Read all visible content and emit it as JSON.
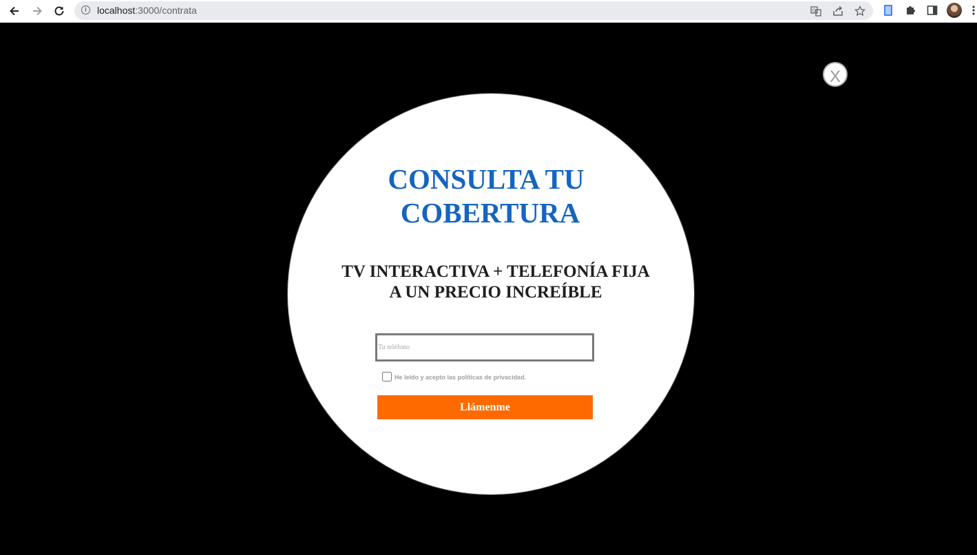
{
  "browser": {
    "url_host": "localhost",
    "url_path": ":3000/contrata",
    "icons": {
      "back": "arrow-left-icon",
      "forward": "arrow-right-icon",
      "reload": "reload-icon",
      "info": "info-icon",
      "translate": "translate-icon",
      "share": "share-icon",
      "bookmark": "star-icon",
      "extension_doc": "document-extension-icon",
      "extensions": "puzzle-icon",
      "side_panel": "side-panel-icon",
      "profile": "avatar",
      "menu": "kebab-menu-icon"
    }
  },
  "modal": {
    "close_label": "X",
    "title_line1": "CONSULTA TU",
    "title_line2": "COBERTURA",
    "subtitle_line1": "TV INTERACTIVA + TELEFONÍA FIJA",
    "subtitle_line2": "A UN PRECIO INCREÍBLE",
    "phone_placeholder": "Tu teléfono",
    "phone_value": "",
    "privacy_label": "He leído y acepto las políticas de privacidad.",
    "privacy_checked": false,
    "submit_label": "Llámenme",
    "colors": {
      "title": "#1565c0",
      "button": "#ff6a00",
      "overlay": "#000000"
    }
  }
}
